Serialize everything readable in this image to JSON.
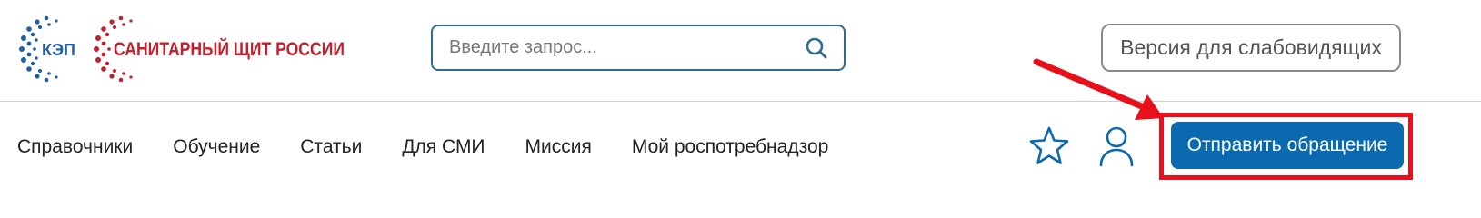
{
  "header": {
    "logo_kep_text": "КЭП",
    "logo_brand_text": "САНИТАРНЫЙ ЩИТ РОССИИ",
    "search": {
      "placeholder": "Введите запрос...",
      "value": ""
    },
    "accessibility_button_label": "Версия для слабовидящих"
  },
  "nav": {
    "items": [
      {
        "label": "Справочники"
      },
      {
        "label": "Обучение"
      },
      {
        "label": "Статьи"
      },
      {
        "label": "Для СМИ"
      },
      {
        "label": "Миссия"
      },
      {
        "label": "Мой роспотребнадзор"
      }
    ],
    "submit_button_label": "Отправить обращение"
  },
  "colors": {
    "accent_blue": "#0b6aaf",
    "search_border": "#2e6b93",
    "annotation_red": "#e8101b",
    "logo_red": "#c1202d",
    "logo_blue": "#1f5fa8"
  },
  "icons": {
    "search": "search-icon",
    "favorites": "star-icon",
    "profile": "user-icon"
  }
}
